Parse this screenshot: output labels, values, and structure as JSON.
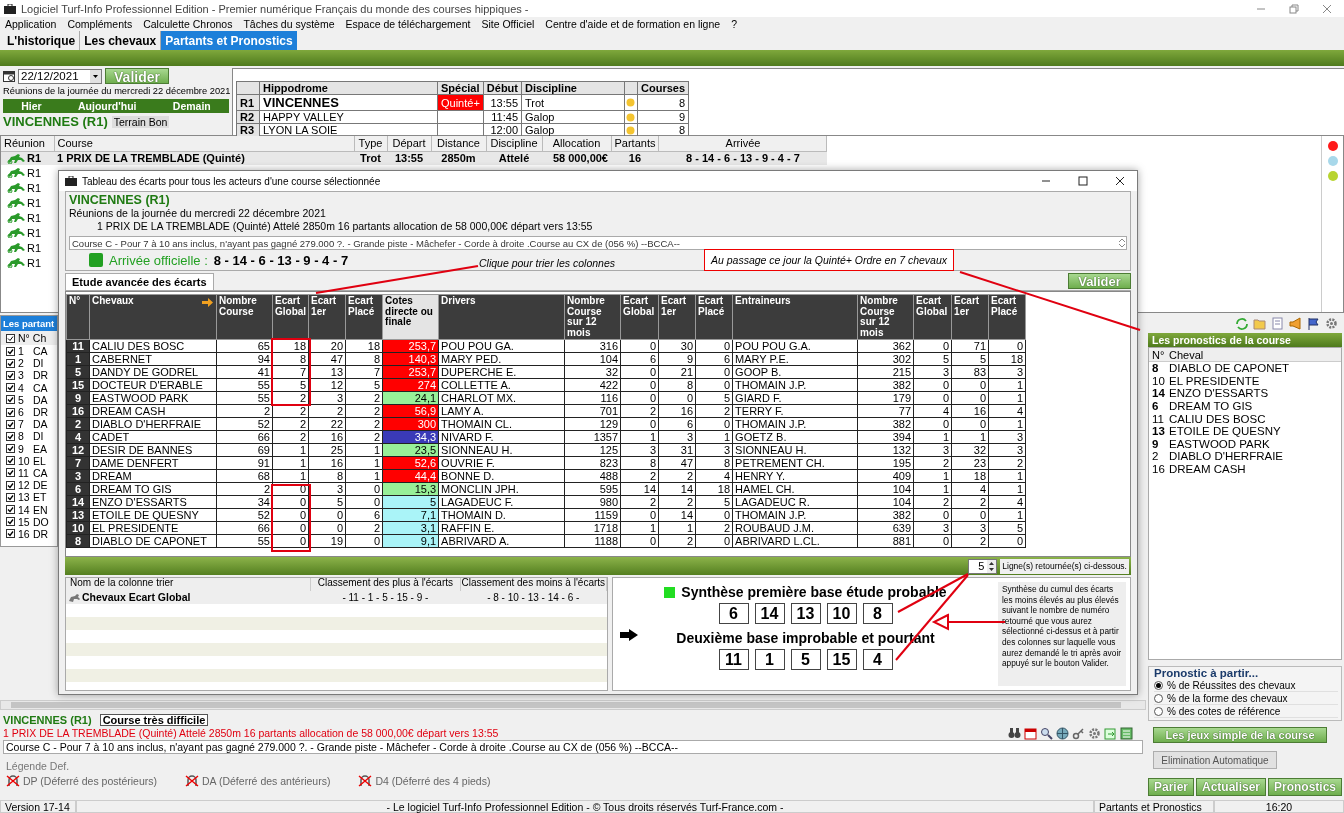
{
  "window": {
    "title": "Logiciel Turf-Info Professionnel Edition - Premier numérique Français du monde des courses hippiques -"
  },
  "menu": [
    "Application",
    "Compléments",
    "Calculette Chronos",
    "Tâches du système",
    "Espace de téléchargement",
    "Site Officiel",
    "Centre d'aide et de formation en ligne",
    "?"
  ],
  "tabs": [
    {
      "label": "L'historique",
      "selected": false
    },
    {
      "label": "Les chevaux",
      "selected": false
    },
    {
      "label": "Partants et Pronostics",
      "selected": true
    }
  ],
  "date_field": {
    "value": "22/12/2021"
  },
  "validate_button": "Valider",
  "reunions_caption": "Réunions de la journée du mercredi 22 décembre 2021",
  "day_nav": [
    "Hier",
    "Aujourd'hui",
    "Demain"
  ],
  "meeting": {
    "title": "VINCENNES (R1)",
    "terrain": "Terrain Bon"
  },
  "hippodromes": {
    "columns": [
      "Hippodrome",
      "Spécial",
      "Début",
      "Discipline",
      "Courses"
    ],
    "rows": [
      {
        "reunion": "R1",
        "name": "VINCENNES",
        "special": "Quinté+",
        "start": "13:55",
        "discipline": "Trot",
        "courses": "8",
        "selected": true
      },
      {
        "reunion": "R2",
        "name": "HAPPY VALLEY",
        "start": "11:45",
        "discipline": "Galop",
        "courses": "9",
        "selected": false
      },
      {
        "reunion": "R3",
        "name": "LYON LA SOIE",
        "start": "12:00",
        "discipline": "Galop",
        "courses": "8",
        "selected": false
      }
    ]
  },
  "courses": {
    "columns": [
      "Réunion",
      "Course",
      "Type",
      "Départ",
      "Distance",
      "Discipline",
      "Allocation",
      "Partants",
      "Arrivée"
    ],
    "rows": [
      {
        "reunion": "R1",
        "course": "1 PRIX DE LA TREMBLADE (Quinté)",
        "type": "Trot",
        "start": "13:55",
        "distance": "2850m",
        "discipline": "Attelé",
        "allocation": "58 000,00€",
        "runners": "16",
        "arrival": "8 - 14 - 6 - 13 - 9 - 4 - 7"
      },
      {
        "reunion": "R1"
      },
      {
        "reunion": "R1"
      },
      {
        "reunion": "R1"
      },
      {
        "reunion": "R1"
      },
      {
        "reunion": "R1"
      },
      {
        "reunion": "R1"
      },
      {
        "reunion": "R1"
      }
    ]
  },
  "status_dots": [
    {
      "color": "#ff1a1a"
    },
    {
      "color": "#a8d8ea"
    },
    {
      "color": "#b8d430"
    }
  ],
  "partants": {
    "title": "Les partant",
    "columns": [
      "N°",
      "Ch"
    ],
    "rows": [
      {
        "number": "1",
        "name": "CA",
        "checked": true
      },
      {
        "number": "2",
        "name": "DI",
        "checked": true
      },
      {
        "number": "3",
        "name": "DR",
        "checked": true
      },
      {
        "number": "4",
        "name": "CA",
        "checked": true
      },
      {
        "number": "5",
        "name": "DA",
        "checked": true
      },
      {
        "number": "6",
        "name": "DR",
        "checked": true
      },
      {
        "number": "7",
        "name": "DA",
        "checked": true
      },
      {
        "number": "8",
        "name": "DI",
        "checked": true
      },
      {
        "number": "9",
        "name": "EA",
        "checked": true
      },
      {
        "number": "10",
        "name": "EL",
        "checked": true
      },
      {
        "number": "11",
        "name": "CA",
        "checked": true
      },
      {
        "number": "12",
        "name": "DE",
        "checked": true
      },
      {
        "number": "13",
        "name": "ET",
        "checked": true
      },
      {
        "number": "14",
        "name": "EN",
        "checked": true
      },
      {
        "number": "15",
        "name": "DO",
        "checked": true
      },
      {
        "number": "16",
        "name": "DR",
        "checked": true
      }
    ]
  },
  "pronostics": {
    "title": "Les pronostics de la course",
    "columns": [
      "N°",
      "Cheval"
    ],
    "rows": [
      {
        "number": "8",
        "name": "DIABLO DE CAPONET",
        "highlighted": true
      },
      {
        "number": "10",
        "name": "EL PRESIDENTE",
        "highlighted": false
      },
      {
        "number": "14",
        "name": "ENZO D'ESSARTS",
        "highlighted": true
      },
      {
        "number": "6",
        "name": "DREAM TO GIS",
        "highlighted": true
      },
      {
        "number": "11",
        "name": "CALIU DES BOSC",
        "highlighted": false
      },
      {
        "number": "13",
        "name": "ETOILE DE QUESNY",
        "highlighted": true
      },
      {
        "number": "9",
        "name": "EASTWOOD PARK",
        "highlighted": true
      },
      {
        "number": "2",
        "name": "DIABLO D'HERFRAIE",
        "highlighted": false
      },
      {
        "number": "16",
        "name": "DREAM CASH",
        "highlighted": false
      }
    ]
  },
  "pronostic_source": {
    "title": "Pronostic à partir...",
    "options": [
      {
        "label": "% de Réussites des chevaux",
        "selected": true
      },
      {
        "label": "% de la forme des chevaux",
        "selected": false
      },
      {
        "label": "% des cotes de référence",
        "selected": false
      }
    ]
  },
  "games_button": "Les jeux simple de la course",
  "elimination_button": "Elimination Automatique",
  "action_buttons": [
    "Parier",
    "Actualiser",
    "Pronostics"
  ],
  "race_info": {
    "meeting": "VINCENNES (R1)",
    "difficulty": "Course très difficile",
    "summary": "1 PRIX DE LA TREMBLADE (Quinté) Attelé 2850m 16 partants allocation de 58 000,00€ départ vers 13:55",
    "conditions": "Course C - Pour 7 à 10 ans inclus, n'ayant pas gagné 279.000 ?. - Grande piste - Mâchefer - Corde à droite .Course au CX de (056 %)  --BCCA--"
  },
  "legend": {
    "title": "Légende Def.",
    "items": [
      "DP (Déferré des postérieurs)",
      "DA (Déferré des antérieurs)",
      "D4 (Déferré des 4 pieds)"
    ]
  },
  "status_bar": [
    "Version 17-14",
    "- Le logiciel Turf-Info Professionnel Edition - © Tous droits réservés Turf-France.com -",
    "Partants et Pronostics",
    "16:20"
  ],
  "dialog": {
    "title": "Tableau des écarts pour tous les acteurs d'une course sélectionnée",
    "meeting": "VINCENNES (R1)",
    "caption": "Réunions de la journée du mercredi 22 décembre 2021",
    "race": "1 PRIX DE LA TREMBLADE (Quinté) Attelé 2850m 16 partants allocation de 58 000,00€ départ vers 13:55",
    "conditions": "Course C - Pour 7 à 10 ans inclus, n'ayant pas gagné 279.000 ?. - Grande piste - Mâchefer - Corde à droite .Course au CX de (056 %)  --BCCA--",
    "arrival_label": "Arrivée officielle :",
    "arrival": "8 - 14 - 6 - 13 - 9 - 4 - 7",
    "hint": "Clique pour trier les colonnes",
    "note": "Au passage ce jour la Quinté+ Ordre en 7 chevaux",
    "tab": "Etude avancée des écarts",
    "validate_button": "Valider",
    "table": {
      "columns": [
        {
          "label": "N°",
          "selected": false
        },
        {
          "label": "Chevaux",
          "selected": false
        },
        {
          "label": "Nombre Course",
          "selected": false
        },
        {
          "label": "Ecart Global",
          "selected": false
        },
        {
          "label": "Ecart 1er",
          "selected": false
        },
        {
          "label": "Ecart Placé",
          "selected": false
        },
        {
          "label": "Cotes directe ou finale",
          "selected": true
        },
        {
          "label": "Drivers",
          "selected": false
        },
        {
          "label": "Nombre Course sur 12 mois",
          "selected": false
        },
        {
          "label": "Ecart Global",
          "selected": false
        },
        {
          "label": "Ecart 1er",
          "selected": false
        },
        {
          "label": "Ecart Placé",
          "selected": false
        },
        {
          "label": "Entraineurs",
          "selected": false
        },
        {
          "label": "Nombre Course sur 12 mois",
          "selected": false
        },
        {
          "label": "Ecart Global",
          "selected": false
        },
        {
          "label": "Ecart 1er",
          "selected": false
        },
        {
          "label": "Ecart Placé",
          "selected": false
        }
      ],
      "rows": [
        {
          "color": "#ff0000",
          "cells": [
            "11",
            "CALIU DES BOSC",
            "65",
            "18",
            "20",
            "18",
            "253,7",
            "POU POU GA.",
            "316",
            "0",
            "30",
            "0",
            "POU POU G.A.",
            "362",
            "0",
            "71",
            "0"
          ]
        },
        {
          "color": "#ff0000",
          "cells": [
            "1",
            "CABERNET",
            "94",
            "8",
            "47",
            "8",
            "140,3",
            "MARY PED.",
            "104",
            "6",
            "9",
            "6",
            "MARY P.E.",
            "302",
            "5",
            "5",
            "18"
          ]
        },
        {
          "color": "#ff0000",
          "cells": [
            "5",
            "DANDY DE GODREL",
            "41",
            "7",
            "13",
            "7",
            "253,7",
            "DUPERCHE E.",
            "32",
            "0",
            "21",
            "0",
            "GOOP B.",
            "215",
            "3",
            "83",
            "3"
          ]
        },
        {
          "color": "#ff0000",
          "cells": [
            "15",
            "DOCTEUR D'ERABLE",
            "55",
            "5",
            "12",
            "5",
            "274",
            "COLLETTE A.",
            "422",
            "0",
            "8",
            "0",
            "THOMAIN J.P.",
            "382",
            "0",
            "0",
            "1"
          ]
        },
        {
          "color": "#98f098",
          "cells": [
            "9",
            "EASTWOOD PARK",
            "55",
            "2",
            "3",
            "2",
            "24,1",
            "CHARLOT MX.",
            "116",
            "0",
            "0",
            "5",
            "GIARD F.",
            "179",
            "0",
            "0",
            "1"
          ]
        },
        {
          "color": "#ff0000",
          "cells": [
            "16",
            "DREAM CASH",
            "2",
            "2",
            "2",
            "2",
            "56,9",
            "LAMY A.",
            "701",
            "2",
            "16",
            "2",
            "TERRY F.",
            "77",
            "4",
            "16",
            "4"
          ]
        },
        {
          "color": "#ff0000",
          "cells": [
            "2",
            "DIABLO D'HERFRAIE",
            "52",
            "2",
            "22",
            "2",
            "300",
            "THOMAIN CL.",
            "129",
            "0",
            "6",
            "0",
            "THOMAIN J.P.",
            "382",
            "0",
            "0",
            "1"
          ]
        },
        {
          "color": "#3a3ab8",
          "cells": [
            "4",
            "CADET",
            "66",
            "2",
            "16",
            "2",
            "34,3",
            "NIVARD F.",
            "1357",
            "1",
            "3",
            "1",
            "GOETZ B.",
            "394",
            "1",
            "1",
            "3"
          ]
        },
        {
          "color": "#98f098",
          "cells": [
            "12",
            "DESIR DE BANNES",
            "69",
            "1",
            "25",
            "1",
            "23,5",
            "SIONNEAU H.",
            "125",
            "3",
            "31",
            "3",
            "SIONNEAU H.",
            "132",
            "3",
            "32",
            "3"
          ]
        },
        {
          "color": "#ff0000",
          "cells": [
            "7",
            "DAME DENFERT",
            "91",
            "1",
            "16",
            "1",
            "52,6",
            "OUVRIE F.",
            "823",
            "8",
            "47",
            "8",
            "PETREMENT CH.",
            "195",
            "2",
            "23",
            "2"
          ]
        },
        {
          "color": "#ff0000",
          "cells": [
            "3",
            "DREAM",
            "68",
            "1",
            "8",
            "1",
            "44,4",
            "BONNE D.",
            "488",
            "2",
            "2",
            "4",
            "HENRY Y.",
            "409",
            "1",
            "18",
            "1"
          ]
        },
        {
          "color": "#98f098",
          "cells": [
            "6",
            "DREAM TO GIS",
            "2",
            "0",
            "3",
            "0",
            "15,3",
            "MONCLIN JPH.",
            "595",
            "14",
            "14",
            "18",
            "HAMEL CH.",
            "104",
            "1",
            "4",
            "1"
          ]
        },
        {
          "color": "#aaf4f8",
          "cells": [
            "14",
            "ENZO D'ESSARTS",
            "34",
            "0",
            "5",
            "0",
            "5",
            "LAGADEUC F.",
            "980",
            "2",
            "2",
            "5",
            "LAGADEUC R.",
            "104",
            "2",
            "2",
            "4"
          ]
        },
        {
          "color": "#aaf4f8",
          "cells": [
            "13",
            "ETOILE DE QUESNY",
            "52",
            "0",
            "0",
            "6",
            "7,1",
            "THOMAIN D.",
            "1159",
            "0",
            "14",
            "0",
            "THOMAIN J.P.",
            "382",
            "0",
            "0",
            "1"
          ]
        },
        {
          "color": "#aaf4f8",
          "cells": [
            "10",
            "EL PRESIDENTE",
            "66",
            "0",
            "0",
            "2",
            "3,1",
            "RAFFIN E.",
            "1718",
            "1",
            "1",
            "2",
            "ROUBAUD J.M.",
            "639",
            "3",
            "3",
            "5"
          ]
        },
        {
          "color": "#aaf4f8",
          "cells": [
            "8",
            "DIABLO DE CAPONET",
            "55",
            "0",
            "19",
            "0",
            "9,1",
            "ABRIVARD A.",
            "1188",
            "0",
            "2",
            "0",
            "ABRIVARD L.CL.",
            "881",
            "0",
            "2",
            "0"
          ]
        }
      ]
    },
    "lines_value": "5",
    "lines_label": "Ligne(s) retournée(s) ci-dessous.",
    "sort_table": {
      "columns": [
        "Nom de la colonne trier",
        "Classement des plus à l'écarts",
        "Classement des moins à l'écarts"
      ],
      "rows": [
        {
          "name": "Chevaux Ecart Global",
          "most": "- 11 - 1 - 5 - 15 - 9 -",
          "least": "- 8 - 10 - 13 - 14 - 6 -"
        }
      ]
    },
    "synthesis": {
      "first_title": "Synthèse première base étude probable",
      "first": [
        "6",
        "14",
        "13",
        "10",
        "8"
      ],
      "second_title": "Deuxième base improbable et pourtant",
      "second": [
        "11",
        "1",
        "5",
        "15",
        "4"
      ]
    },
    "explanation": "Synthèse du cumul des écarts les moins élevés au plus élevés suivant le nombre de numéro retourné que vous aurez sélectionné ci-dessus et à partir des colonnes sur laquelle vous aurez demandé le tri après avoir appuyé sur le bouton Valider."
  }
}
